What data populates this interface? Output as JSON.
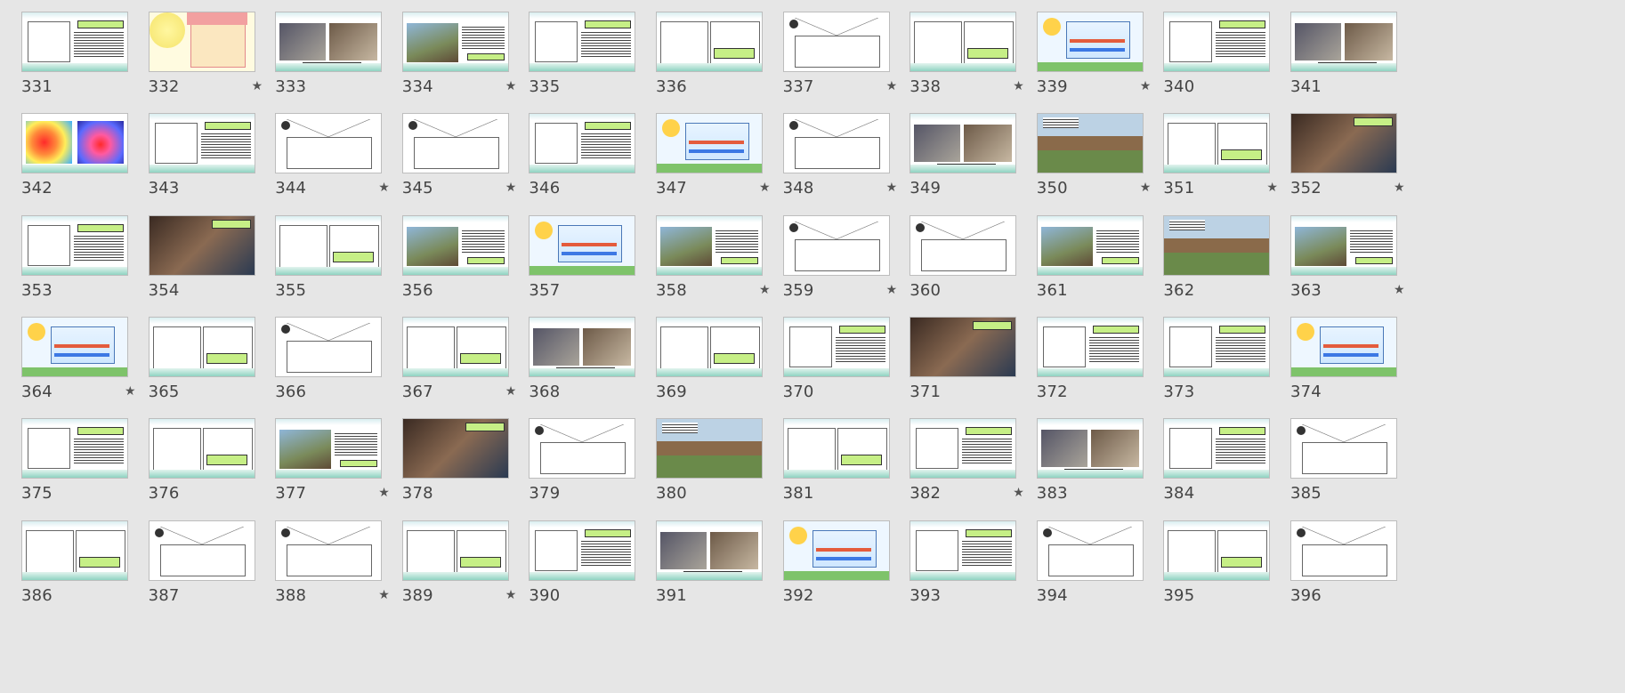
{
  "rows": [
    [
      {
        "n": "331",
        "star": false,
        "v": 0
      },
      {
        "n": "332",
        "star": true,
        "v": 1
      },
      {
        "n": "333",
        "star": false,
        "v": 2
      },
      {
        "n": "334",
        "star": true,
        "v": 3
      },
      {
        "n": "335",
        "star": false,
        "v": 0
      },
      {
        "n": "336",
        "star": false,
        "v": 4
      },
      {
        "n": "337",
        "star": true,
        "v": 5
      },
      {
        "n": "338",
        "star": true,
        "v": 4
      },
      {
        "n": "339",
        "star": true,
        "v": 6
      },
      {
        "n": "340",
        "star": false,
        "v": 0
      },
      {
        "n": "341",
        "star": false,
        "v": 2
      }
    ],
    [
      {
        "n": "342",
        "star": false,
        "v": 7
      },
      {
        "n": "343",
        "star": false,
        "v": 0
      },
      {
        "n": "344",
        "star": true,
        "v": 5
      },
      {
        "n": "345",
        "star": true,
        "v": 5
      },
      {
        "n": "346",
        "star": false,
        "v": 0
      },
      {
        "n": "347",
        "star": true,
        "v": 6
      },
      {
        "n": "348",
        "star": true,
        "v": 5
      },
      {
        "n": "349",
        "star": false,
        "v": 2
      },
      {
        "n": "350",
        "star": true,
        "v": 8
      },
      {
        "n": "351",
        "star": true,
        "v": 4
      },
      {
        "n": "352",
        "star": true,
        "v": 9
      }
    ],
    [
      {
        "n": "353",
        "star": false,
        "v": 0
      },
      {
        "n": "354",
        "star": false,
        "v": 9
      },
      {
        "n": "355",
        "star": false,
        "v": 4
      },
      {
        "n": "356",
        "star": false,
        "v": 3
      },
      {
        "n": "357",
        "star": false,
        "v": 6
      },
      {
        "n": "358",
        "star": true,
        "v": 3
      },
      {
        "n": "359",
        "star": true,
        "v": 5
      },
      {
        "n": "360",
        "star": false,
        "v": 5
      },
      {
        "n": "361",
        "star": false,
        "v": 3
      },
      {
        "n": "362",
        "star": false,
        "v": 8
      },
      {
        "n": "363",
        "star": true,
        "v": 3
      }
    ],
    [
      {
        "n": "364",
        "star": true,
        "v": 6
      },
      {
        "n": "365",
        "star": false,
        "v": 4
      },
      {
        "n": "366",
        "star": false,
        "v": 5
      },
      {
        "n": "367",
        "star": true,
        "v": 4
      },
      {
        "n": "368",
        "star": false,
        "v": 2
      },
      {
        "n": "369",
        "star": false,
        "v": 4
      },
      {
        "n": "370",
        "star": false,
        "v": 0
      },
      {
        "n": "371",
        "star": false,
        "v": 9
      },
      {
        "n": "372",
        "star": false,
        "v": 0
      },
      {
        "n": "373",
        "star": false,
        "v": 0
      },
      {
        "n": "374",
        "star": false,
        "v": 6
      }
    ],
    [
      {
        "n": "375",
        "star": false,
        "v": 0
      },
      {
        "n": "376",
        "star": false,
        "v": 4
      },
      {
        "n": "377",
        "star": true,
        "v": 3
      },
      {
        "n": "378",
        "star": false,
        "v": 9
      },
      {
        "n": "379",
        "star": false,
        "v": 5
      },
      {
        "n": "380",
        "star": false,
        "v": 8
      },
      {
        "n": "381",
        "star": false,
        "v": 4
      },
      {
        "n": "382",
        "star": true,
        "v": 0
      },
      {
        "n": "383",
        "star": false,
        "v": 2
      },
      {
        "n": "384",
        "star": false,
        "v": 0
      },
      {
        "n": "385",
        "star": false,
        "v": 5
      }
    ],
    [
      {
        "n": "386",
        "star": false,
        "v": 4
      },
      {
        "n": "387",
        "star": false,
        "v": 5
      },
      {
        "n": "388",
        "star": true,
        "v": 5
      },
      {
        "n": "389",
        "star": true,
        "v": 4
      },
      {
        "n": "390",
        "star": false,
        "v": 0
      },
      {
        "n": "391",
        "star": false,
        "v": 2
      },
      {
        "n": "392",
        "star": false,
        "v": 6
      },
      {
        "n": "393",
        "star": false,
        "v": 0
      },
      {
        "n": "394",
        "star": false,
        "v": 5
      },
      {
        "n": "395",
        "star": false,
        "v": 4
      },
      {
        "n": "396",
        "star": false,
        "v": 5
      }
    ]
  ],
  "star_glyph": "★",
  "colors": {
    "background": "#e6e6e6",
    "accent_green": "#c6ef86",
    "teal": "#8fd3c2"
  }
}
